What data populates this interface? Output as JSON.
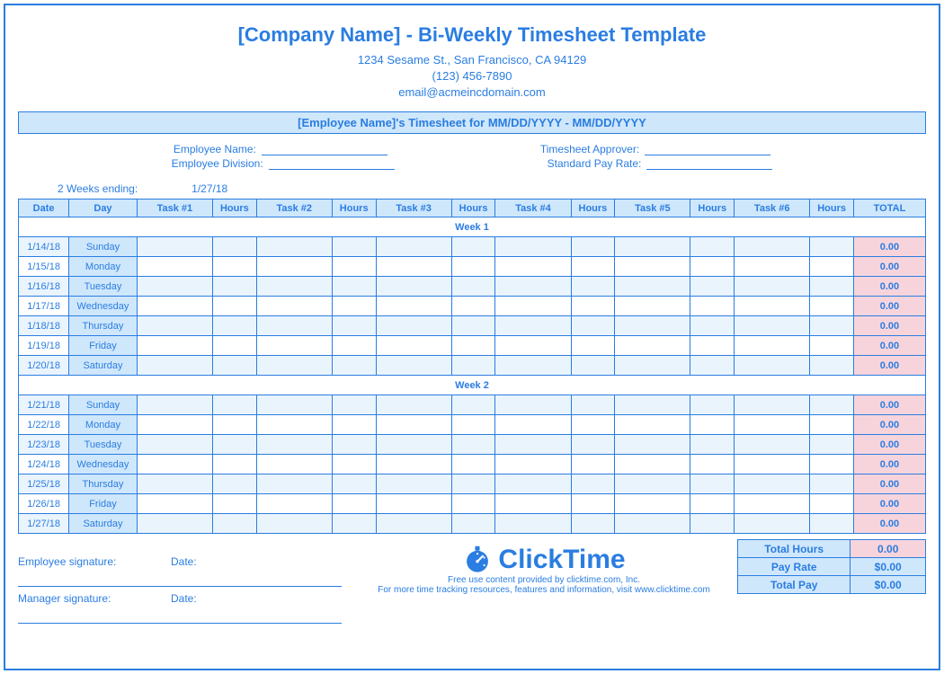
{
  "header": {
    "title": "[Company Name] - Bi-Weekly Timesheet Template",
    "address": "1234 Sesame St.,  San Francisco, CA 94129",
    "phone": "(123) 456-7890",
    "email": "email@acmeincdomain.com"
  },
  "banner": "[Employee Name]'s Timesheet for MM/DD/YYYY - MM/DD/YYYY",
  "meta": {
    "emp_name_label": "Employee Name:",
    "emp_div_label": "Employee Division:",
    "approver_label": "Timesheet Approver:",
    "pay_rate_label": "Standard Pay Rate:",
    "emp_name": "",
    "emp_div": "",
    "approver": "",
    "pay_rate": ""
  },
  "ending": {
    "label": "2 Weeks ending:",
    "value": "1/27/18"
  },
  "columns": [
    "Date",
    "Day",
    "Task #1",
    "Hours",
    "Task #2",
    "Hours",
    "Task #3",
    "Hours",
    "Task #4",
    "Hours",
    "Task #5",
    "Hours",
    "Task #6",
    "Hours",
    "TOTAL"
  ],
  "week1_label": "Week 1",
  "week2_label": "Week 2",
  "week1": [
    {
      "date": "1/14/18",
      "day": "Sunday",
      "total": "0.00"
    },
    {
      "date": "1/15/18",
      "day": "Monday",
      "total": "0.00"
    },
    {
      "date": "1/16/18",
      "day": "Tuesday",
      "total": "0.00"
    },
    {
      "date": "1/17/18",
      "day": "Wednesday",
      "total": "0.00"
    },
    {
      "date": "1/18/18",
      "day": "Thursday",
      "total": "0.00"
    },
    {
      "date": "1/19/18",
      "day": "Friday",
      "total": "0.00"
    },
    {
      "date": "1/20/18",
      "day": "Saturday",
      "total": "0.00"
    }
  ],
  "week2": [
    {
      "date": "1/21/18",
      "day": "Sunday",
      "total": "0.00"
    },
    {
      "date": "1/22/18",
      "day": "Monday",
      "total": "0.00"
    },
    {
      "date": "1/23/18",
      "day": "Tuesday",
      "total": "0.00"
    },
    {
      "date": "1/24/18",
      "day": "Wednesday",
      "total": "0.00"
    },
    {
      "date": "1/25/18",
      "day": "Thursday",
      "total": "0.00"
    },
    {
      "date": "1/26/18",
      "day": "Friday",
      "total": "0.00"
    },
    {
      "date": "1/27/18",
      "day": "Saturday",
      "total": "0.00"
    }
  ],
  "summary": {
    "total_hours_label": "Total Hours",
    "total_hours": "0.00",
    "pay_rate_label": "Pay Rate",
    "pay_rate": "$0.00",
    "total_pay_label": "Total Pay",
    "total_pay": "$0.00"
  },
  "signatures": {
    "employee_label": "Employee signature:",
    "manager_label": "Manager signature:",
    "date_label": "Date:"
  },
  "brand": {
    "name": "ClickTime",
    "line1": "Free use content provided by clicktime.com, Inc.",
    "line2": "For more time tracking resources, features and information, visit www.clicktime.com"
  }
}
